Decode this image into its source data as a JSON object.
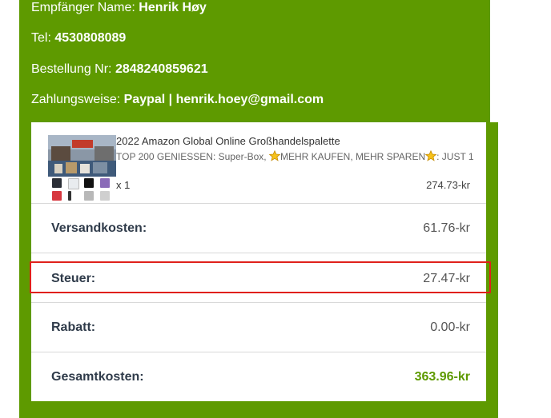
{
  "info": {
    "recipient_label": "Empfänger Name: ",
    "recipient_value": "Henrik Høy",
    "phone_label": "Tel: ",
    "phone_value": "4530808089",
    "order_label": "Bestellung Nr: ",
    "order_value": "2848240859621",
    "payment_label": "Zahlungsweise: ",
    "payment_value": "Paypal | henrik.hoey@gmail.com"
  },
  "product": {
    "title": "2022 Amazon Global Online Großhandelspalette",
    "subtitle_part1": "TOP 200 GENIESSEN: Super-Box, ",
    "subtitle_part2": "MEHR KAUFEN, MEHR SPAREN",
    "subtitle_part3": ": JUST 1",
    "quantity": "x 1",
    "price": "274.73-kr",
    "icon_names": [
      "star-icon"
    ]
  },
  "summary": {
    "shipping_label": "Versandkosten:",
    "shipping_value": "61.76-kr",
    "tax_label": "Steuer:",
    "tax_value": "27.47-kr",
    "discount_label": "Rabatt:",
    "discount_value": "0.00-kr",
    "total_label": "Gesamtkosten:",
    "total_value": "363.96-kr"
  },
  "colors": {
    "brand_green": "#5e9a00",
    "highlight_red": "#e0201b"
  }
}
